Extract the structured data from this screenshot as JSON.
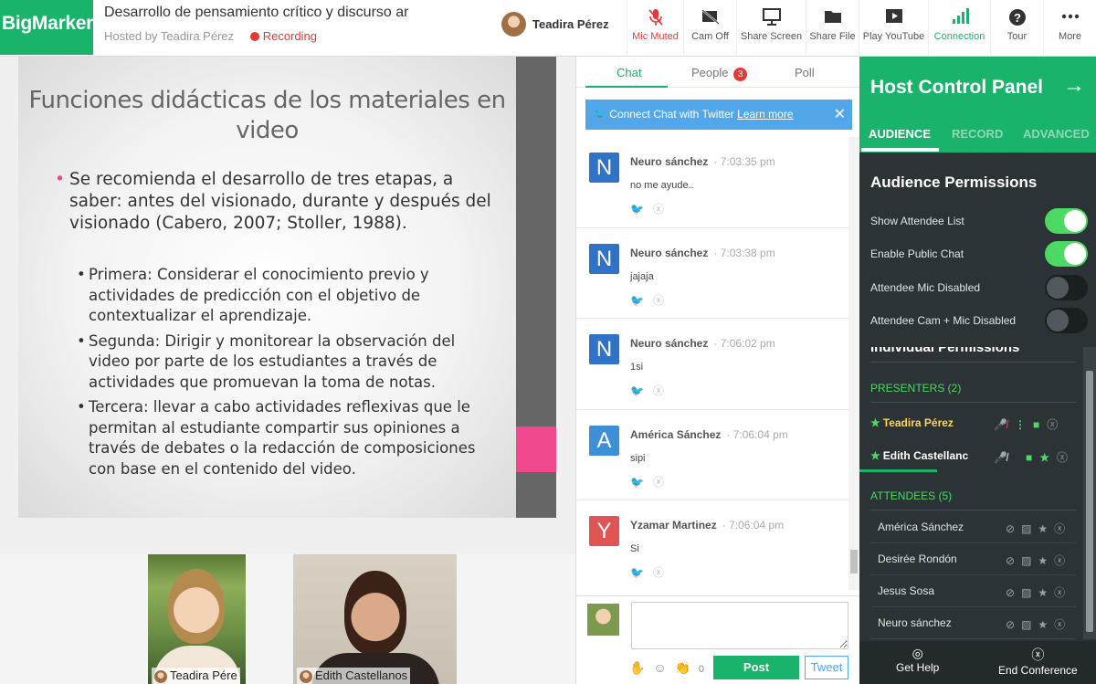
{
  "app": {
    "logo": "BigMarker",
    "title": "Desarrollo de pensamiento crítico y discurso ar",
    "hosted_by": "Hosted by Teadira Pérez",
    "recording": "Recording",
    "user_name": "Teadira Pérez"
  },
  "toolbar": {
    "mic": "Mic Muted",
    "cam": "Cam Off",
    "share_screen": "Share Screen",
    "share_file": "Share File",
    "youtube": "Play YouTube",
    "connection": "Connection",
    "tour": "Tour",
    "more": "More"
  },
  "slide": {
    "title": "Funciones didácticas de los materiales en video",
    "main_bullet": "Se recomienda el desarrollo de tres etapas, a saber: antes del visionado, durante y después del visionado (Cabero, 2007; Stoller, 1988).",
    "sub_bullets": [
      "Primera: Considerar el conocimiento previo y actividades de predicción con el objetivo de contextualizar el aprendizaje.",
      "Segunda: Dirigir y monitorear la observación del video por parte de los estudiantes a través de actividades que promuevan la toma de notas.",
      "Tercera: llevar a cabo actividades reflexivas que le permitan al estudiante compartir sus opiniones a través de debates o la redacción de composiciones con base en el contenido del video."
    ]
  },
  "cams": [
    {
      "name": "Teadira Pére"
    },
    {
      "name": "Edith Castellanos"
    }
  ],
  "chat": {
    "tabs": {
      "chat": "Chat",
      "people": "People",
      "people_count": "3",
      "poll": "Poll"
    },
    "twitter_text": "Connect Chat with Twitter",
    "twitter_link": "Learn more",
    "messages": [
      {
        "initial": "N",
        "color": "#2f73c9",
        "name": "Neuro sánchez",
        "time": "· 7:03:35 pm",
        "text": "no me ayude.."
      },
      {
        "initial": "N",
        "color": "#2f73c9",
        "name": "Neuro sánchez",
        "time": "· 7:03:38 pm",
        "text": "jajaja"
      },
      {
        "initial": "N",
        "color": "#2f73c9",
        "name": "Neuro sánchez",
        "time": "· 7:06:02 pm",
        "text": "1si"
      },
      {
        "initial": "A",
        "color": "#3d8fd6",
        "name": "América Sánchez",
        "time": "· 7:06:04 pm",
        "text": "sipi"
      },
      {
        "initial": "Y",
        "color": "#e25454",
        "name": "Yzamar Martinez",
        "time": "· 7:06:04 pm",
        "text": "Si"
      }
    ],
    "reaction_count": "0",
    "post_label": "Post",
    "tweet_label": "Tweet"
  },
  "host": {
    "title": "Host Control Panel",
    "tabs": {
      "audience": "AUDIENCE",
      "record": "RECORD",
      "advanced": "ADVANCED"
    },
    "audience_title": "Audience Permissions",
    "permissions": [
      {
        "label": "Show Attendee List",
        "on": true
      },
      {
        "label": "Enable Public Chat",
        "on": true
      },
      {
        "label": "Attendee Mic Disabled",
        "on": false
      },
      {
        "label": "Attendee Cam + Mic Disabled",
        "on": false
      }
    ],
    "individual_title": "Individual Permissions",
    "presenters_title": "PRESENTERS (2)",
    "presenters": [
      "Teadira Pérez",
      "Edith Castellanc"
    ],
    "attendees_title": "ATTENDEES (5)",
    "attendees": [
      "América Sánchez",
      "Desirée Rondón",
      "Jesus Sosa",
      "Neuro sánchez"
    ],
    "footer": {
      "help": "Get Help",
      "end": "End Conference"
    }
  }
}
